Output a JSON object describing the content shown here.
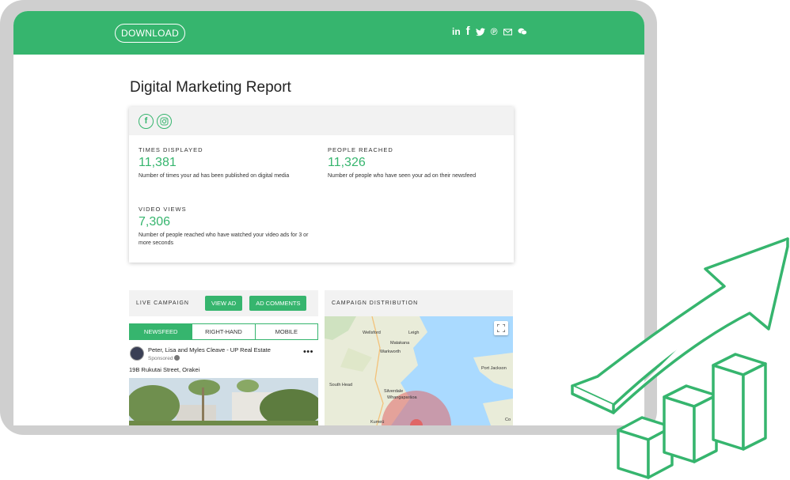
{
  "header": {
    "download_label": "DOWNLOAD"
  },
  "social_icons": [
    {
      "name": "linkedin-icon",
      "glyph": "in"
    },
    {
      "name": "facebook-icon",
      "glyph": "f"
    },
    {
      "name": "twitter-icon"
    },
    {
      "name": "pinterest-icon",
      "glyph": "℗"
    },
    {
      "name": "email-icon"
    },
    {
      "name": "wechat-icon"
    }
  ],
  "report": {
    "title": "Digital Marketing Report"
  },
  "platforms": {
    "facebook_glyph": "f",
    "instagram_glyph": "◎"
  },
  "stats": {
    "times_displayed": {
      "label": "TIMES DISPLAYED",
      "value": "11,381",
      "desc": "Number of times your ad has been published on digital media"
    },
    "people_reached": {
      "label": "PEOPLE REACHED",
      "value": "11,326",
      "desc": "Number of people who have seen your ad on their newsfeed"
    },
    "video_views": {
      "label": "VIDEO VIEWS",
      "value": "7,306",
      "desc": "Number of people reached who have watched your video ads for 3 or more seconds"
    }
  },
  "live_campaign": {
    "label": "LIVE CAMPAIGN",
    "view_ad_label": "VIEW AD",
    "ad_comments_label": "AD COMMENTS",
    "tabs": [
      "NEWSFEED",
      "RIGHT-HAND",
      "MOBILE"
    ],
    "post": {
      "poster": "Peter, Lisa and Myles Cleave - UP Real Estate",
      "sponsored": "Sponsored",
      "more": "•••",
      "address": "19B Rukutai Street, Orakei"
    }
  },
  "campaign_distribution": {
    "label": "CAMPAIGN DISTRIBUTION",
    "places": [
      "Wellsford",
      "Leigh",
      "Matakana",
      "Warkworth",
      "Port Jackson",
      "South Head",
      "Silverdale",
      "Whangaparāoa",
      "Kumeū",
      "Co"
    ]
  },
  "colors": {
    "brand_green": "#36b56e",
    "frame_gray": "#cfcfcf"
  }
}
